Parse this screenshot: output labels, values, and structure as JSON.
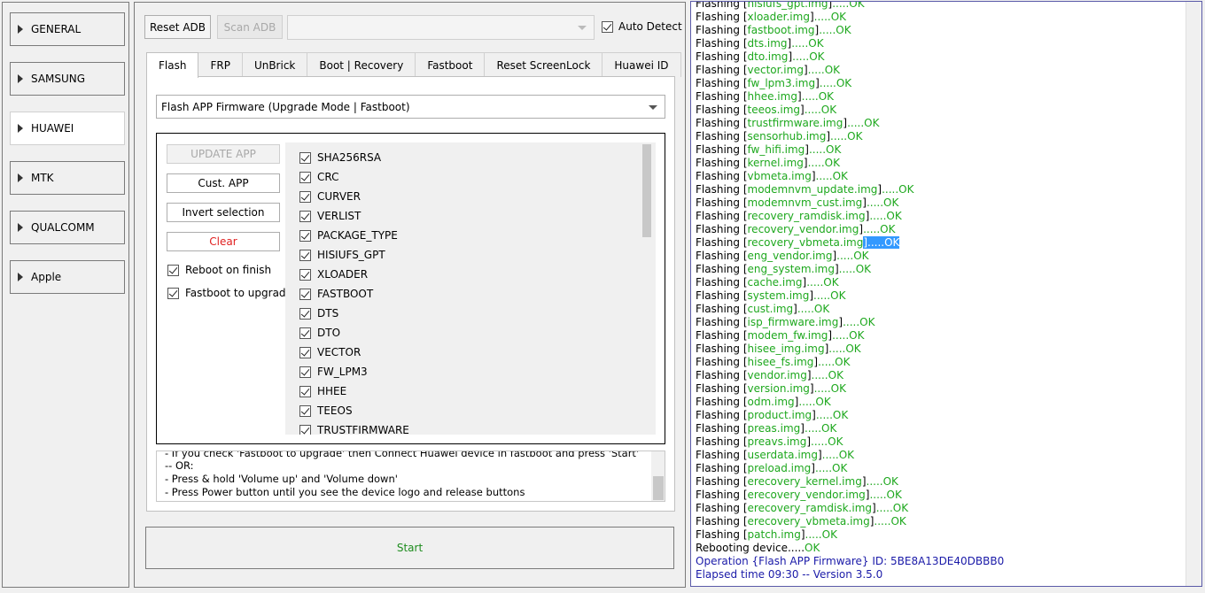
{
  "sidebar": {
    "items": [
      {
        "label": "GENERAL",
        "active": false
      },
      {
        "label": "SAMSUNG",
        "active": false
      },
      {
        "label": "HUAWEI",
        "active": true
      },
      {
        "label": "MTK",
        "active": false
      },
      {
        "label": "QUALCOMM",
        "active": false
      },
      {
        "label": "Apple",
        "active": false
      }
    ]
  },
  "toolbar": {
    "reset_adb": "Reset ADB",
    "scan_adb": "Scan ADB",
    "device_combo_value": "",
    "auto_detect_label": "Auto Detect",
    "auto_detect_checked": true
  },
  "tabs": [
    "Flash",
    "FRP",
    "UnBrick",
    "Boot | Recovery",
    "Fastboot",
    "Reset ScreenLock",
    "Huawei ID"
  ],
  "active_tab": "Flash",
  "flash": {
    "mode_select": "Flash APP Firmware (Upgrade Mode | Fastboot)",
    "update_app": "UPDATE APP",
    "cust_app": "Cust. APP",
    "invert_selection": "Invert selection",
    "clear": "Clear",
    "reboot_on_finish": "Reboot on finish",
    "fastboot_to_upgrade": "Fastboot to upgrade",
    "partitions": [
      "SHA256RSA",
      "CRC",
      "CURVER",
      "VERLIST",
      "PACKAGE_TYPE",
      "HISIUFS_GPT",
      "XLOADER",
      "FASTBOOT",
      "DTS",
      "DTO",
      "VECTOR",
      "FW_LPM3",
      "HHEE",
      "TEEOS",
      "TRUSTFIRMWARE"
    ],
    "instructions": [
      "- If you check 'Fastboot to upgrade' then Connect Huawei device in fastboot and press 'Start'",
      "-- OR:",
      "- Press & hold 'Volume up' and 'Volume down'",
      "- Press Power button until you see the device logo and release buttons"
    ],
    "start": "Start"
  },
  "log": {
    "flash_lines": [
      {
        "file": "hisiufs_gpt.img"
      },
      {
        "file": "xloader.img"
      },
      {
        "file": "fastboot.img"
      },
      {
        "file": "dts.img"
      },
      {
        "file": "dto.img"
      },
      {
        "file": "vector.img"
      },
      {
        "file": "fw_lpm3.img"
      },
      {
        "file": "hhee.img"
      },
      {
        "file": "teeos.img"
      },
      {
        "file": "trustfirmware.img"
      },
      {
        "file": "sensorhub.img"
      },
      {
        "file": "fw_hifi.img"
      },
      {
        "file": "kernel.img"
      },
      {
        "file": "vbmeta.img"
      },
      {
        "file": "modemnvm_update.img"
      },
      {
        "file": "modemnvm_cust.img"
      },
      {
        "file": "recovery_ramdisk.img"
      },
      {
        "file": "recovery_vendor.img"
      },
      {
        "file": "recovery_vbmeta.img",
        "selected": true
      },
      {
        "file": "eng_vendor.img"
      },
      {
        "file": "eng_system.img"
      },
      {
        "file": "cache.img"
      },
      {
        "file": "system.img"
      },
      {
        "file": "cust.img"
      },
      {
        "file": "isp_firmware.img"
      },
      {
        "file": "modem_fw.img"
      },
      {
        "file": "hisee_img.img"
      },
      {
        "file": "hisee_fs.img"
      },
      {
        "file": "vendor.img"
      },
      {
        "file": "version.img"
      },
      {
        "file": "odm.img"
      },
      {
        "file": "product.img"
      },
      {
        "file": "preas.img"
      },
      {
        "file": "preavs.img"
      },
      {
        "file": "userdata.img"
      },
      {
        "file": "preload.img"
      },
      {
        "file": "erecovery_kernel.img"
      },
      {
        "file": "erecovery_vendor.img"
      },
      {
        "file": "erecovery_ramdisk.img"
      },
      {
        "file": "erecovery_vbmeta.img"
      },
      {
        "file": "patch.img"
      }
    ],
    "flashing_word": "Flashing",
    "ok_suffix": ".....OK",
    "rebooting_text": "Rebooting device.....",
    "rebooting_ok": "OK",
    "operation_line": "Operation {Flash APP Firmware} ID: 5BE8A13DE40DBBB0",
    "elapsed_line": "Elapsed time 09:30 -- Version 3.5.0"
  },
  "colors": {
    "ok_green": "#1ea81e",
    "info_blue": "#1a1aa8",
    "clear_red": "#e02020",
    "selection_blue": "#3399ff"
  }
}
